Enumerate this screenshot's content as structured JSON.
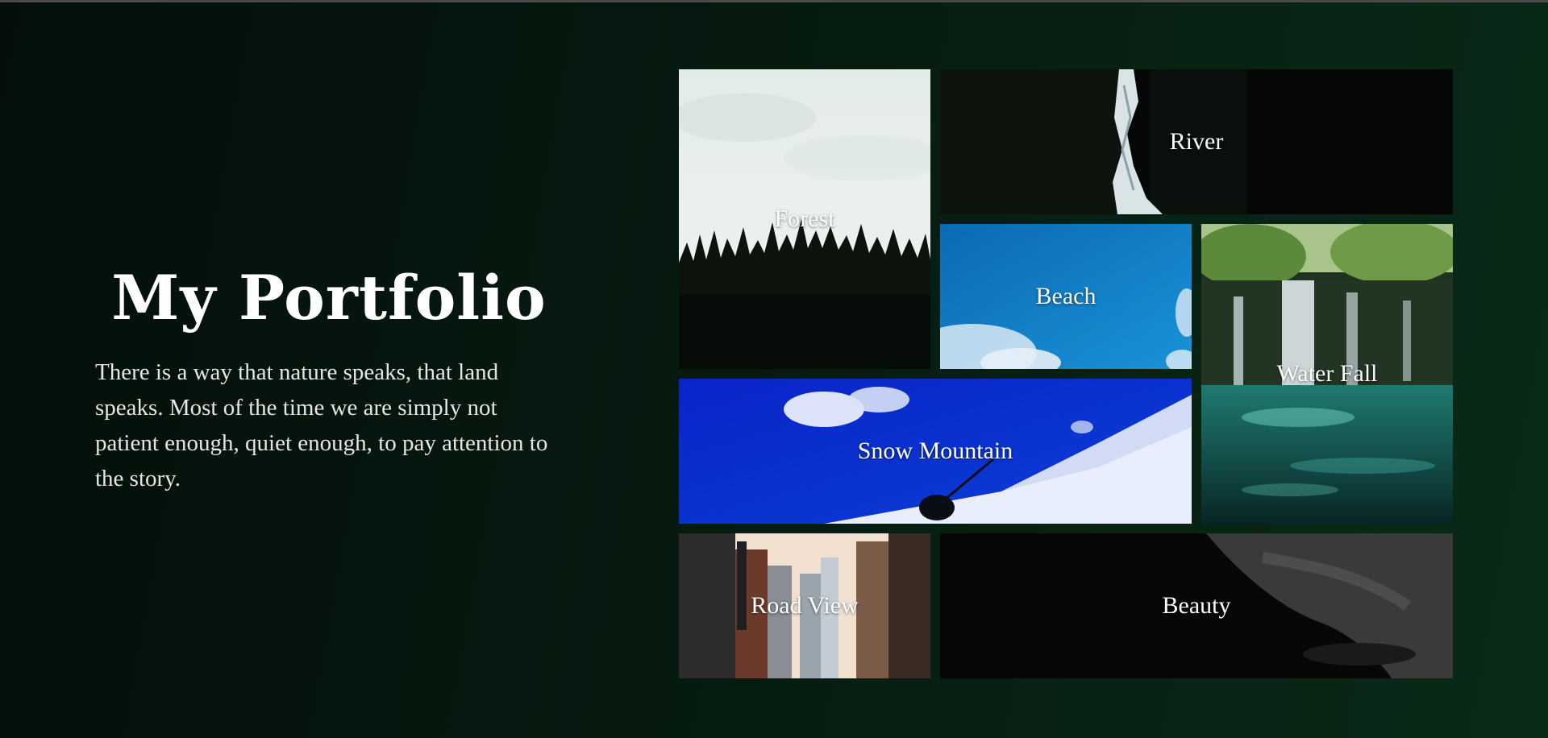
{
  "intro": {
    "title": "My Portfolio",
    "description": "There is a way that nature speaks, that land speaks. Most of the time we are simply not patient enough, quiet enough, to pay attention to the story."
  },
  "gallery": {
    "tiles": [
      {
        "label": "Forest"
      },
      {
        "label": "River"
      },
      {
        "label": "Beach"
      },
      {
        "label": "Water Fall"
      },
      {
        "label": "Snow Mountain"
      },
      {
        "label": "Road View"
      },
      {
        "label": "Beauty"
      }
    ]
  },
  "colors": {
    "background_start": "#040f0a",
    "background_end": "#0a2a17",
    "text": "#ffffff"
  }
}
